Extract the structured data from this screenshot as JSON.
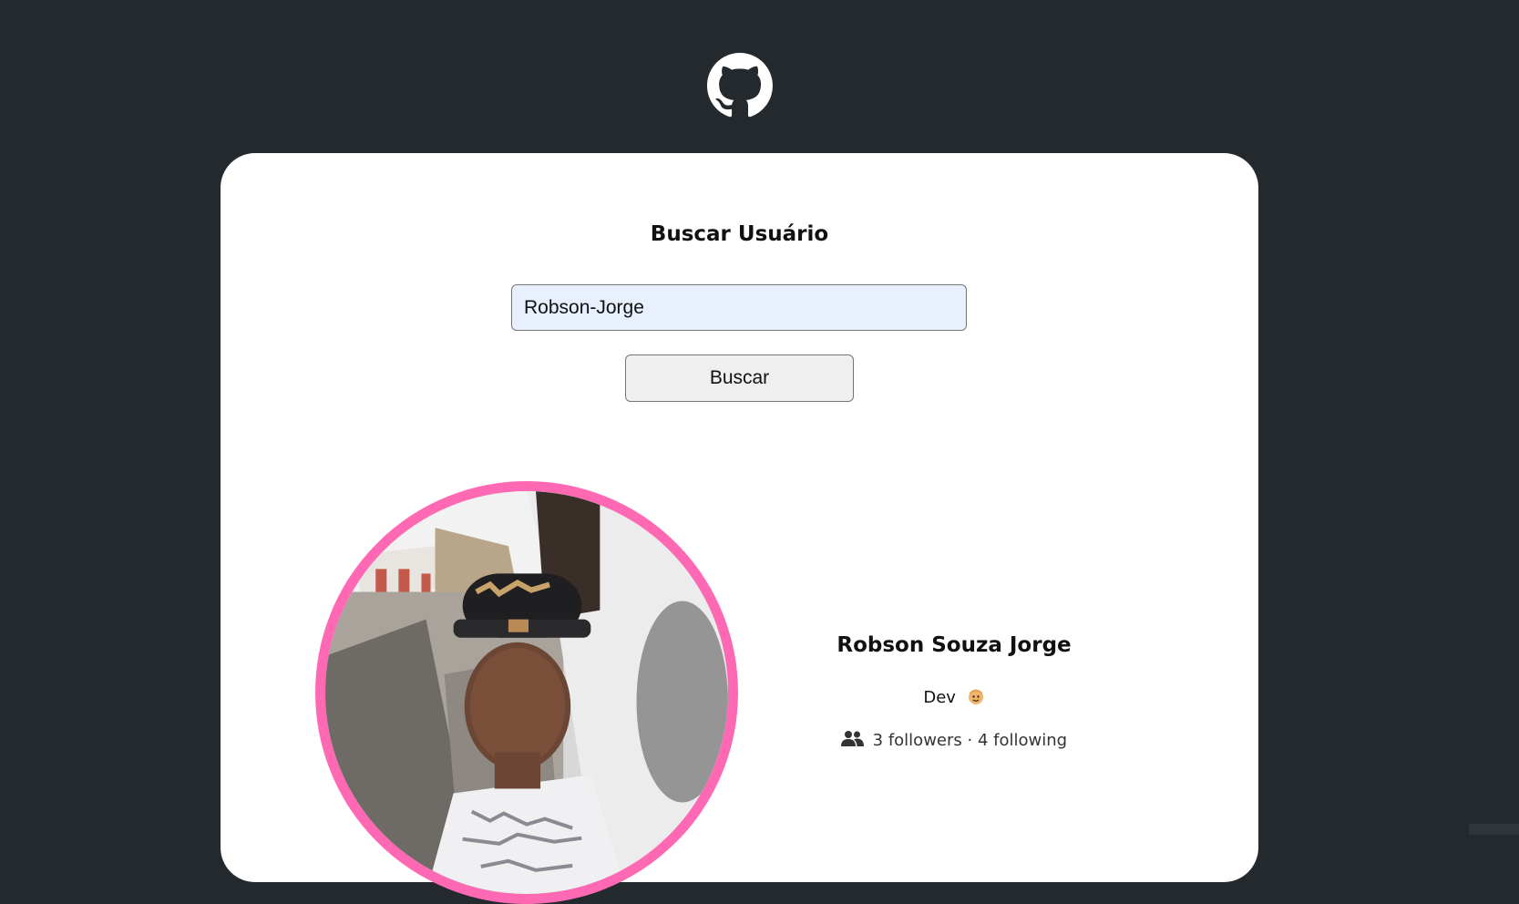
{
  "header": {
    "logo_icon": "github-octocat-icon"
  },
  "search": {
    "title": "Buscar Usuário",
    "input_value": "Robson-Jorge",
    "button_label": "Buscar"
  },
  "profile": {
    "avatar_icon": "user-avatar-photo",
    "name": "Robson Souza Jorge",
    "bio": "Dev",
    "bio_emoji_icon": "dev-emoji-icon",
    "followers_count": "3",
    "followers_label": "followers",
    "separator": "·",
    "following_count": "4",
    "following_label": "following"
  },
  "colors": {
    "background": "#24292e",
    "card": "#ffffff",
    "avatar_border": "#ff69b4",
    "input_background": "#e8f0fe"
  }
}
